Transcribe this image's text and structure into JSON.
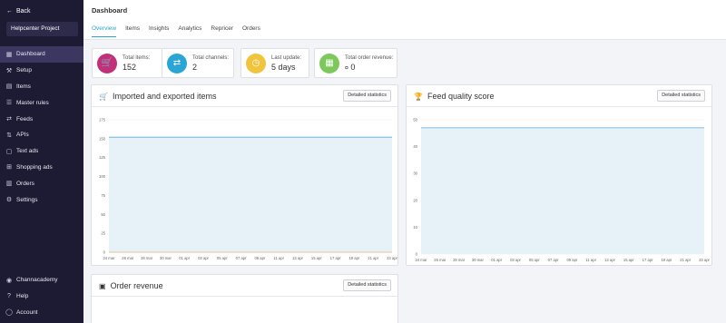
{
  "sidebar": {
    "back_label": "Back",
    "project_name": "Helpcenter Project",
    "items": [
      {
        "label": "Dashboard",
        "icon": "dashboard-icon",
        "active": true
      },
      {
        "label": "Setup",
        "icon": "setup-icon"
      },
      {
        "label": "Items",
        "icon": "items-icon"
      },
      {
        "label": "Master rules",
        "icon": "rules-icon"
      },
      {
        "label": "Feeds",
        "icon": "feeds-icon"
      },
      {
        "label": "APIs",
        "icon": "api-icon"
      },
      {
        "label": "Text ads",
        "icon": "text-ads-icon"
      },
      {
        "label": "Shopping ads",
        "icon": "shopping-icon"
      },
      {
        "label": "Orders",
        "icon": "orders-icon"
      },
      {
        "label": "Settings",
        "icon": "settings-icon"
      }
    ],
    "bottom_items": [
      {
        "label": "Channacademy",
        "icon": "academy-icon"
      },
      {
        "label": "Help",
        "icon": "help-icon"
      },
      {
        "label": "Account",
        "icon": "account-icon"
      }
    ]
  },
  "header": {
    "title": "Dashboard",
    "tabs": [
      "Overview",
      "Items",
      "Insights",
      "Analytics",
      "Repricer",
      "Orders"
    ],
    "active_tab": "Overview"
  },
  "kpis": [
    {
      "label": "Total items:",
      "value": "152",
      "color": "#c2307a",
      "icon": "cart-icon"
    },
    {
      "label": "Total channels:",
      "value": "2",
      "color": "#2aa6d6",
      "icon": "swap-icon"
    },
    {
      "label": "Last update:",
      "value": "5 days",
      "color": "#f0c43c",
      "icon": "clock-icon"
    },
    {
      "label": "Total order revenue:",
      "value": "0",
      "color": "#7cc85a",
      "icon": "calculator-icon",
      "value_icon": "currency-icon"
    }
  ],
  "cards": {
    "imported": {
      "title": "Imported and exported items",
      "button": "Detailed statistics"
    },
    "feed_quality": {
      "title": "Feed quality score",
      "button": "Detailed statistics"
    },
    "revenue": {
      "title": "Order revenue",
      "button": "Detailed statistics"
    }
  },
  "chart_data": [
    {
      "type": "area",
      "title": "Imported and exported items",
      "categories": [
        "24 mar",
        "26 mar",
        "28 mar",
        "30 mar",
        "01 apr",
        "03 apr",
        "05 apr",
        "07 apr",
        "09 apr",
        "11 apr",
        "13 apr",
        "15 apr",
        "17 apr",
        "19 apr",
        "21 apr",
        "23 apr"
      ],
      "series": [
        {
          "values": [
            152,
            152,
            152,
            152,
            152,
            152,
            152,
            152,
            152,
            152,
            152,
            152,
            152,
            152,
            152,
            152
          ]
        },
        {
          "values": [
            0,
            0,
            0,
            0,
            0,
            0,
            0,
            0,
            0,
            0,
            0,
            0,
            0,
            0,
            0,
            0
          ]
        }
      ],
      "ylim": [
        0,
        175
      ],
      "yticks": [
        0,
        25,
        50,
        75,
        100,
        125,
        150,
        175
      ],
      "grid": true
    },
    {
      "type": "area",
      "title": "Feed quality score",
      "categories": [
        "24 mar",
        "26 mar",
        "28 mar",
        "30 mar",
        "01 apr",
        "03 apr",
        "05 apr",
        "07 apr",
        "09 apr",
        "11 apr",
        "13 apr",
        "15 apr",
        "17 apr",
        "19 apr",
        "21 apr",
        "23 apr"
      ],
      "series": [
        {
          "values": [
            47,
            47,
            47,
            47,
            47,
            47,
            47,
            47,
            47,
            47,
            47,
            47,
            47,
            47,
            47,
            47
          ]
        }
      ],
      "ylim": [
        0,
        50
      ],
      "yticks": [
        0,
        10,
        20,
        30,
        40,
        50
      ],
      "grid": true
    }
  ],
  "colors": {
    "sidebar_bg": "#1d1a33",
    "accent": "#2aa6c8",
    "line": "#5aaed1",
    "area": "#e6f2f8"
  }
}
